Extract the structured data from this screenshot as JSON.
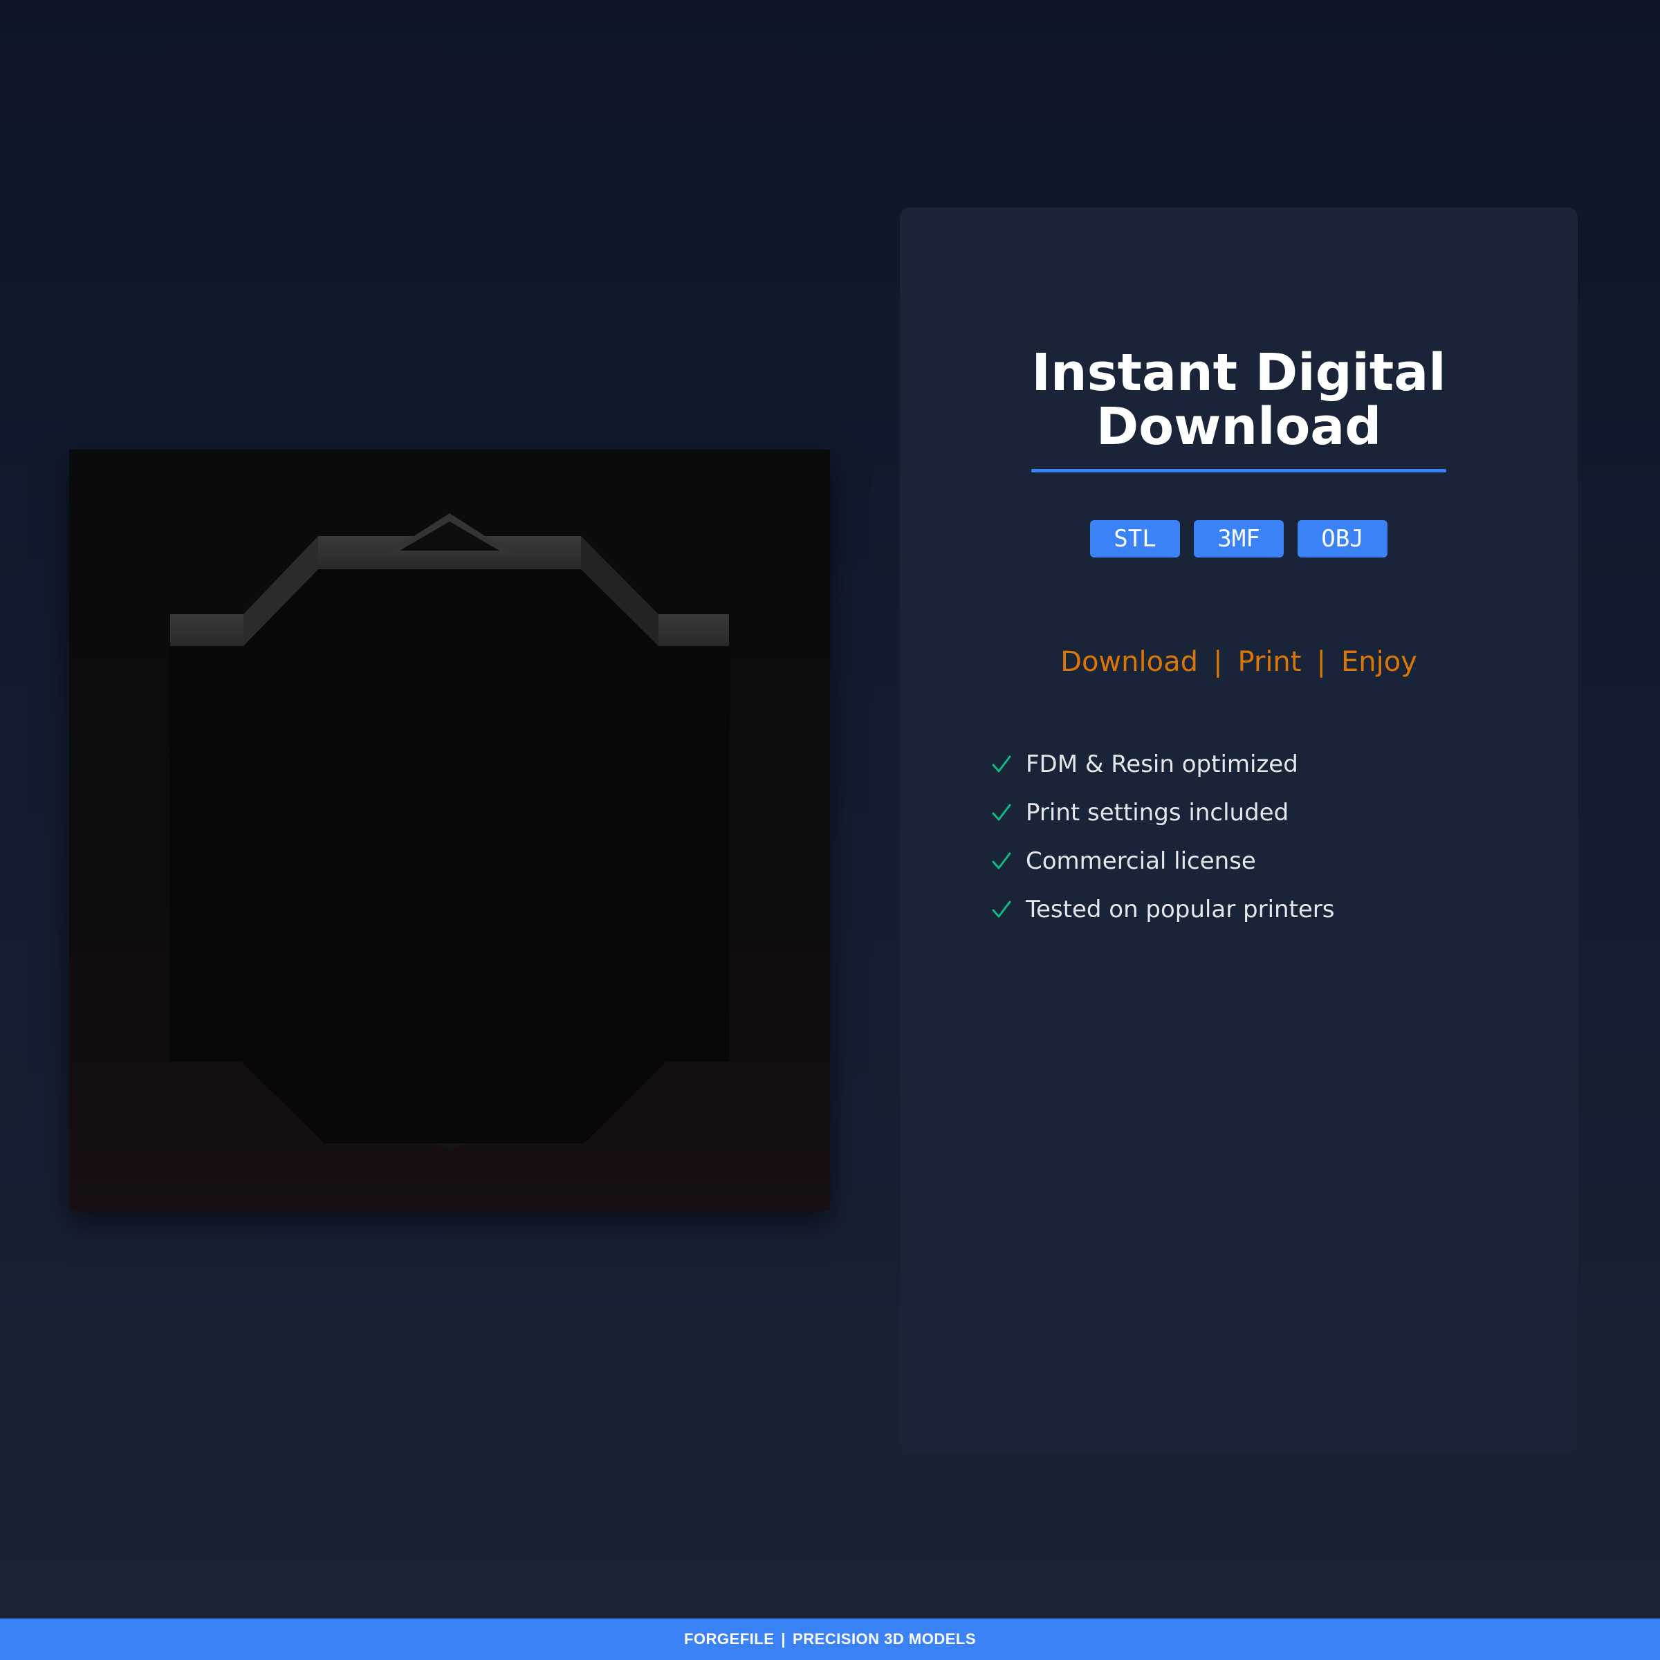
{
  "product": {
    "image": "dark-3d-model-render"
  },
  "card": {
    "title": "Instant Digital Download",
    "formats": [
      "STL",
      "3MF",
      "OBJ"
    ],
    "tagline": [
      "Download",
      "Print",
      "Enjoy"
    ],
    "features": [
      "FDM & Resin optimized",
      "Print settings included",
      "Commercial license",
      "Tested on popular printers"
    ],
    "feature_icon": "check-icon"
  },
  "footer": {
    "brand": "FORGEFILE",
    "separator": "|",
    "slogan": "PRECISION 3D MODELS"
  },
  "colors": {
    "accent": "#3b82f6",
    "tagline": "#d97706",
    "check": "#10b981",
    "background": "#131c31",
    "card": "#1a2438"
  }
}
